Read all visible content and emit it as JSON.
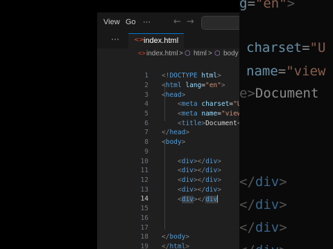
{
  "menu": {
    "view": "View",
    "go": "Go",
    "more": "···"
  },
  "nav": {
    "back": "←",
    "forward": "→"
  },
  "tabs": {
    "overflow": "···",
    "active_icon": "<>",
    "active_label": "index.html"
  },
  "breadcrumb": {
    "file_icon": "<>",
    "file": "index.html",
    "sep": ">",
    "node_icon": "⬡",
    "node1": "html",
    "node2": "body"
  },
  "editor": {
    "line_numbers": [
      "1",
      "2",
      "3",
      "4",
      "5",
      "6",
      "7",
      "8",
      "9",
      "10",
      "11",
      "12",
      "13",
      "14",
      "15",
      "16",
      "17",
      "18",
      "19"
    ],
    "active_line": "14",
    "lines": {
      "l1": {
        "p1": "<!",
        "t": "DOCTYPE",
        "a": " html",
        "p2": ">"
      },
      "l2": {
        "p1": "<",
        "t": "html",
        "a": " lang",
        "eq": "=",
        "s": "\"en\"",
        "p2": ">"
      },
      "l3": {
        "p1": "<",
        "t": "head",
        "p2": ">"
      },
      "l4": {
        "p1": "<",
        "t": "meta",
        "a": " charset",
        "eq": "=",
        "s": "\"U"
      },
      "l5": {
        "p1": "<",
        "t": "meta",
        "a": " name",
        "eq": "=",
        "s": "\"view"
      },
      "l6": {
        "p1": "<",
        "t": "title",
        "p2": ">",
        "x": "Document",
        "p3": "<"
      },
      "l7": {
        "p1": "</",
        "t": "head",
        "p2": ">"
      },
      "l8": {
        "p1": "<",
        "t": "body",
        "p2": ">"
      },
      "div": {
        "p1": "<",
        "t": "div",
        "p2": "></",
        "p3": ">"
      },
      "l18": {
        "p1": "</",
        "t": "body",
        "p2": ">"
      },
      "l19": {
        "p1": "</",
        "t": "html",
        "p2": ">"
      }
    }
  },
  "zoom": {
    "z1": "g=\"en\">",
    "z2": "charset=\"U",
    "z3": "name=\"view",
    "z4a": "e>",
    "z4b": "Document",
    "z5": "</div>"
  },
  "colors": {
    "tag": "#569cd6",
    "attr": "#9cdcfe",
    "string": "#ce9178",
    "punct": "#808080",
    "tab_accent": "#0078d4",
    "html_icon": "#e44d26"
  }
}
